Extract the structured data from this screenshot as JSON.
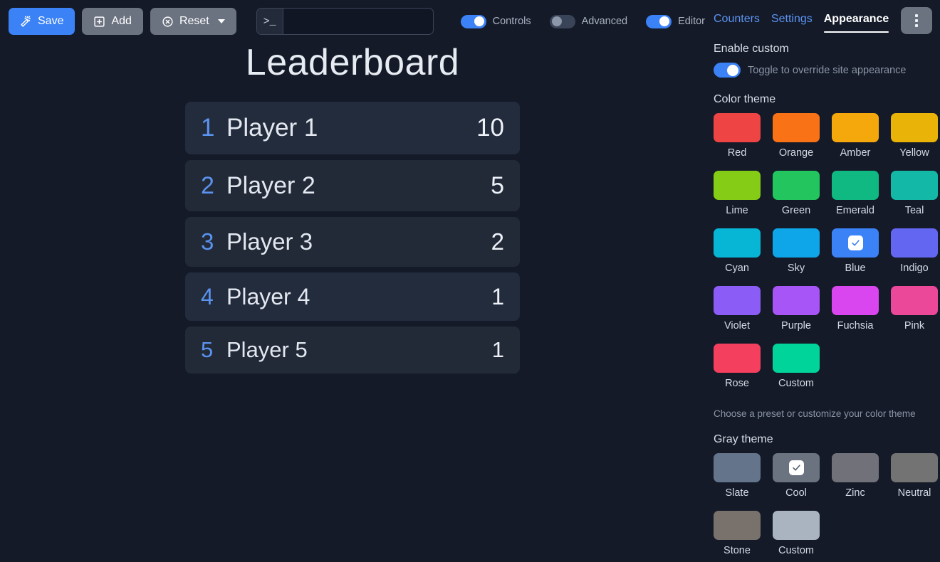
{
  "toolbar": {
    "save_label": "Save",
    "save_icon": "magic-wand-icon",
    "add_label": "Add",
    "add_icon": "plus-square-icon",
    "reset_label": "Reset",
    "reset_icon": "x-circle-icon",
    "terminal_prefix": ">_",
    "terminal_value": "",
    "terminal_placeholder": "",
    "toggles": [
      {
        "label": "Controls",
        "on": true
      },
      {
        "label": "Advanced",
        "on": false
      },
      {
        "label": "Editor",
        "on": true
      }
    ]
  },
  "board": {
    "title": "Leaderboard",
    "rows": [
      {
        "rank": "1",
        "name": "Player 1",
        "score": "10"
      },
      {
        "rank": "2",
        "name": "Player 2",
        "score": "5"
      },
      {
        "rank": "3",
        "name": "Player 3",
        "score": "2"
      },
      {
        "rank": "4",
        "name": "Player 4",
        "score": "1"
      },
      {
        "rank": "5",
        "name": "Player 5",
        "score": "1"
      }
    ]
  },
  "panel": {
    "tabs": [
      {
        "label": "Counters",
        "active": false
      },
      {
        "label": "Settings",
        "active": false
      },
      {
        "label": "Appearance",
        "active": true
      }
    ],
    "menu_icon": "kebab-menu-icon",
    "enable_custom": {
      "title": "Enable custom",
      "toggle_label": "Toggle to override site appearance",
      "on": true
    },
    "color_theme": {
      "title": "Color theme",
      "hint": "Choose a preset or customize your color theme",
      "selected": "Blue",
      "swatches": [
        {
          "label": "Red",
          "color": "#ef4444"
        },
        {
          "label": "Orange",
          "color": "#f97316"
        },
        {
          "label": "Amber",
          "color": "#f5a80b"
        },
        {
          "label": "Yellow",
          "color": "#eab308"
        },
        {
          "label": "Lime",
          "color": "#84cc16"
        },
        {
          "label": "Green",
          "color": "#22c55e"
        },
        {
          "label": "Emerald",
          "color": "#10b981"
        },
        {
          "label": "Teal",
          "color": "#14b8a6"
        },
        {
          "label": "Cyan",
          "color": "#06b6d4"
        },
        {
          "label": "Sky",
          "color": "#0ea5e9"
        },
        {
          "label": "Blue",
          "color": "#3b82f6"
        },
        {
          "label": "Indigo",
          "color": "#6366f1"
        },
        {
          "label": "Violet",
          "color": "#8b5cf6"
        },
        {
          "label": "Purple",
          "color": "#a855f7"
        },
        {
          "label": "Fuchsia",
          "color": "#d946ef"
        },
        {
          "label": "Pink",
          "color": "#ec4899"
        },
        {
          "label": "Rose",
          "color": "#f43f5e"
        },
        {
          "label": "Custom",
          "color": "#00d49a"
        }
      ]
    },
    "gray_theme": {
      "title": "Gray theme",
      "selected": "Cool",
      "swatches": [
        {
          "label": "Slate",
          "color": "#64748b"
        },
        {
          "label": "Cool",
          "color": "#6b7280"
        },
        {
          "label": "Zinc",
          "color": "#71717a"
        },
        {
          "label": "Neutral",
          "color": "#737373"
        },
        {
          "label": "Stone",
          "color": "#78716c"
        },
        {
          "label": "Custom",
          "color": "#aab4c0"
        }
      ]
    }
  }
}
